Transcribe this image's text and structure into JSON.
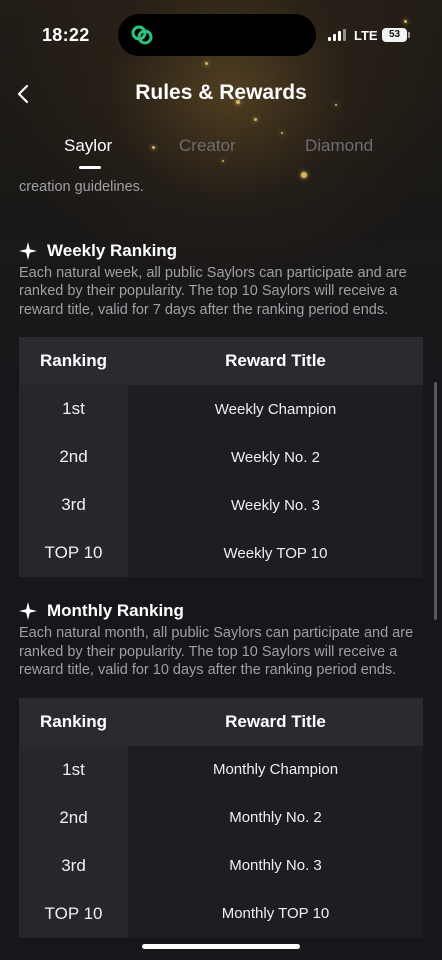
{
  "status": {
    "time": "18:22",
    "network": "LTE",
    "battery": "53"
  },
  "header": {
    "title": "Rules & Rewards"
  },
  "tabs": [
    {
      "label": "Saylor",
      "active": true
    },
    {
      "label": "Creator",
      "active": false
    },
    {
      "label": "Diamond",
      "active": false
    }
  ],
  "intro_tail": "creation guidelines.",
  "weekly": {
    "heading": "Weekly Ranking",
    "description": "Each natural week, all public Saylors can participate and are ranked by their popularity. The top 10 Saylors will receive a reward title, valid for 7 days after the ranking period ends.",
    "columns": [
      "Ranking",
      "Reward Title"
    ],
    "rows": [
      [
        "1st",
        "Weekly Champion"
      ],
      [
        "2nd",
        "Weekly No. 2"
      ],
      [
        "3rd",
        "Weekly No. 3"
      ],
      [
        "TOP 10",
        "Weekly TOP 10"
      ]
    ]
  },
  "monthly": {
    "heading": "Monthly Ranking",
    "description": "Each natural month, all public Saylors can participate and are ranked by their popularity. The top 10 Saylors will receive a reward title, valid for 10 days after the ranking period ends.",
    "columns": [
      "Ranking",
      "Reward Title"
    ],
    "rows": [
      [
        "1st",
        "Monthly Champion"
      ],
      [
        "2nd",
        "Monthly No. 2"
      ],
      [
        "3rd",
        "Monthly No. 3"
      ],
      [
        "TOP 10",
        "Monthly TOP 10"
      ]
    ]
  },
  "icons": {
    "back": "chevron-left-icon",
    "section": "sparkle-star-icon",
    "island": "link-icon"
  },
  "colors": {
    "island_icon": "#2ec27e",
    "sparkle": "#d6b457"
  }
}
